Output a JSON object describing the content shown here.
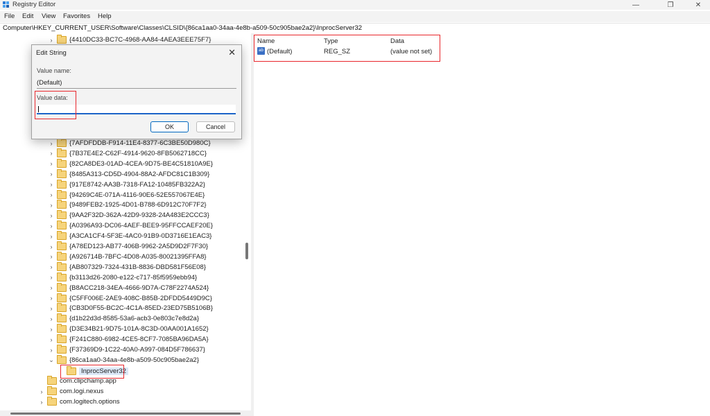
{
  "window": {
    "title": "Registry Editor",
    "controls": {
      "minimize": "—",
      "maximize": "❐",
      "close": "✕"
    }
  },
  "menu": [
    "File",
    "Edit",
    "View",
    "Favorites",
    "Help"
  ],
  "address": "Computer\\HKEY_CURRENT_USER\\Software\\Classes\\CLSID\\{86ca1aa0-34aa-4e8b-a509-50c905bae2a2}\\InprocServer32",
  "tree": {
    "top_item": "{4410DC33-BC7C-4968-AA84-4AEA3EEE75F7}",
    "items": [
      "{7AFDFDDB-F914-11E4-8377-6C3BE50D980C}",
      "{7B37E4E2-C62F-4914-9620-8FB5062718CC}",
      "{82CA8DE3-01AD-4CEA-9D75-BE4C51810A9E}",
      "{8485A313-CD5D-4904-88A2-AFDC81C1B309}",
      "{917E8742-AA3B-7318-FA12-10485FB322A2}",
      "{94269C4E-071A-4116-90E6-52E557067E4E}",
      "{9489FEB2-1925-4D01-B788-6D912C70F7F2}",
      "{9AA2F32D-362A-42D9-9328-24A483E2CCC3}",
      "{A0396A93-DC06-4AEF-BEE9-95FFCCAEF20E}",
      "{A3CA1CF4-5F3E-4AC0-91B9-0D3716E1EAC3}",
      "{A78ED123-AB77-406B-9962-2A5D9D2F7F30}",
      "{A926714B-7BFC-4D08-A035-80021395FFA8}",
      "{AB807329-7324-431B-8836-DBD581F56E08}",
      "{b3113d26-2080-e122-c717-85f5959ebb94}",
      "{B8ACC218-34EA-4666-9D7A-C78F2274A524}",
      "{C5FF006E-2AE9-408C-B85B-2DFDD5449D9C}",
      "{CB3D0F55-BC2C-4C1A-85ED-23ED75B5106B}",
      "{d1b22d3d-8585-53a6-acb3-0e803c7e8d2a}",
      "{D3E34B21-9D75-101A-8C3D-00AA001A1652}",
      "{F241C880-6982-4CE5-8CF7-7085BA96DA5A}",
      "{F37369D9-1C22-40A0-A997-084D5F786637}",
      "{86ca1aa0-34aa-4e8b-a509-50c905bae2a2}"
    ],
    "selected_child": "InprocServer32",
    "bottom_items": [
      "com.clipchamp.app",
      "com.logi.nexus",
      "com.logitech.options"
    ]
  },
  "values": {
    "headers": {
      "name": "Name",
      "type": "Type",
      "data": "Data"
    },
    "rows": [
      {
        "icon": "ab",
        "name": "(Default)",
        "type": "REG_SZ",
        "data": "(value not set)"
      }
    ]
  },
  "dialog": {
    "title": "Edit String",
    "close": "✕",
    "value_name_label": "Value name:",
    "value_name": "(Default)",
    "value_data_label": "Value data:",
    "value_data": "",
    "ok_label": "OK",
    "cancel_label": "Cancel"
  },
  "colors": {
    "highlight": "#e8262b",
    "input_focus": "#1c64c8",
    "folder": "#f6d47c"
  }
}
